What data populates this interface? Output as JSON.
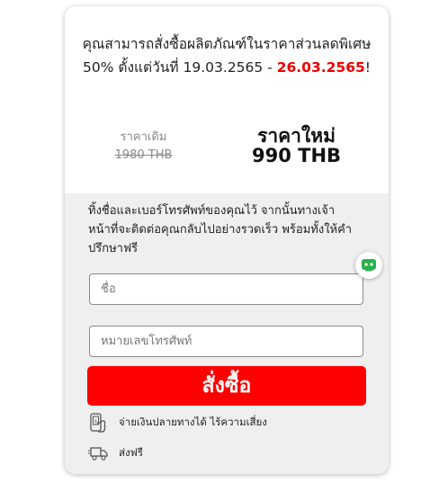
{
  "promo": {
    "text_prefix": "คุณสามารถสั่งซื้อผลิตภัณฑ์ในราคาส่วนลดพิเศษ 50% ตั้งแต่วันที่ 19.03.2565 -",
    "end_date": "26.03.2565",
    "suffix": "!"
  },
  "price": {
    "old_label": "ราคาเดิม",
    "old_value": "1980 THB",
    "new_label": "ราคาใหม่",
    "new_value": "990 THB"
  },
  "form": {
    "instruction": "ทิ้งชื่อและเบอร์โทรศัพท์ของคุณไว้ จากนั้นทางเจ้าหน้าที่จะติดต่อคุณกลับไปอย่างรวดเร็ว พร้อมทั้งให้คำปรึกษาฟรี",
    "name_placeholder": "ชื่อ",
    "phone_placeholder": "หมายเลขโทรศัพท์",
    "submit_label": "สั่งซื้อ"
  },
  "features": [
    {
      "icon": "cash-on-delivery-icon",
      "text": "จ่ายเงินปลายทางได้ ไร้ความเสี่ยง"
    },
    {
      "icon": "delivery-truck-icon",
      "text": "ส่งฟรี"
    }
  ],
  "colors": {
    "accent": "#ff0000",
    "chat_accent": "#2bb24c",
    "form_background": "#efefef"
  }
}
